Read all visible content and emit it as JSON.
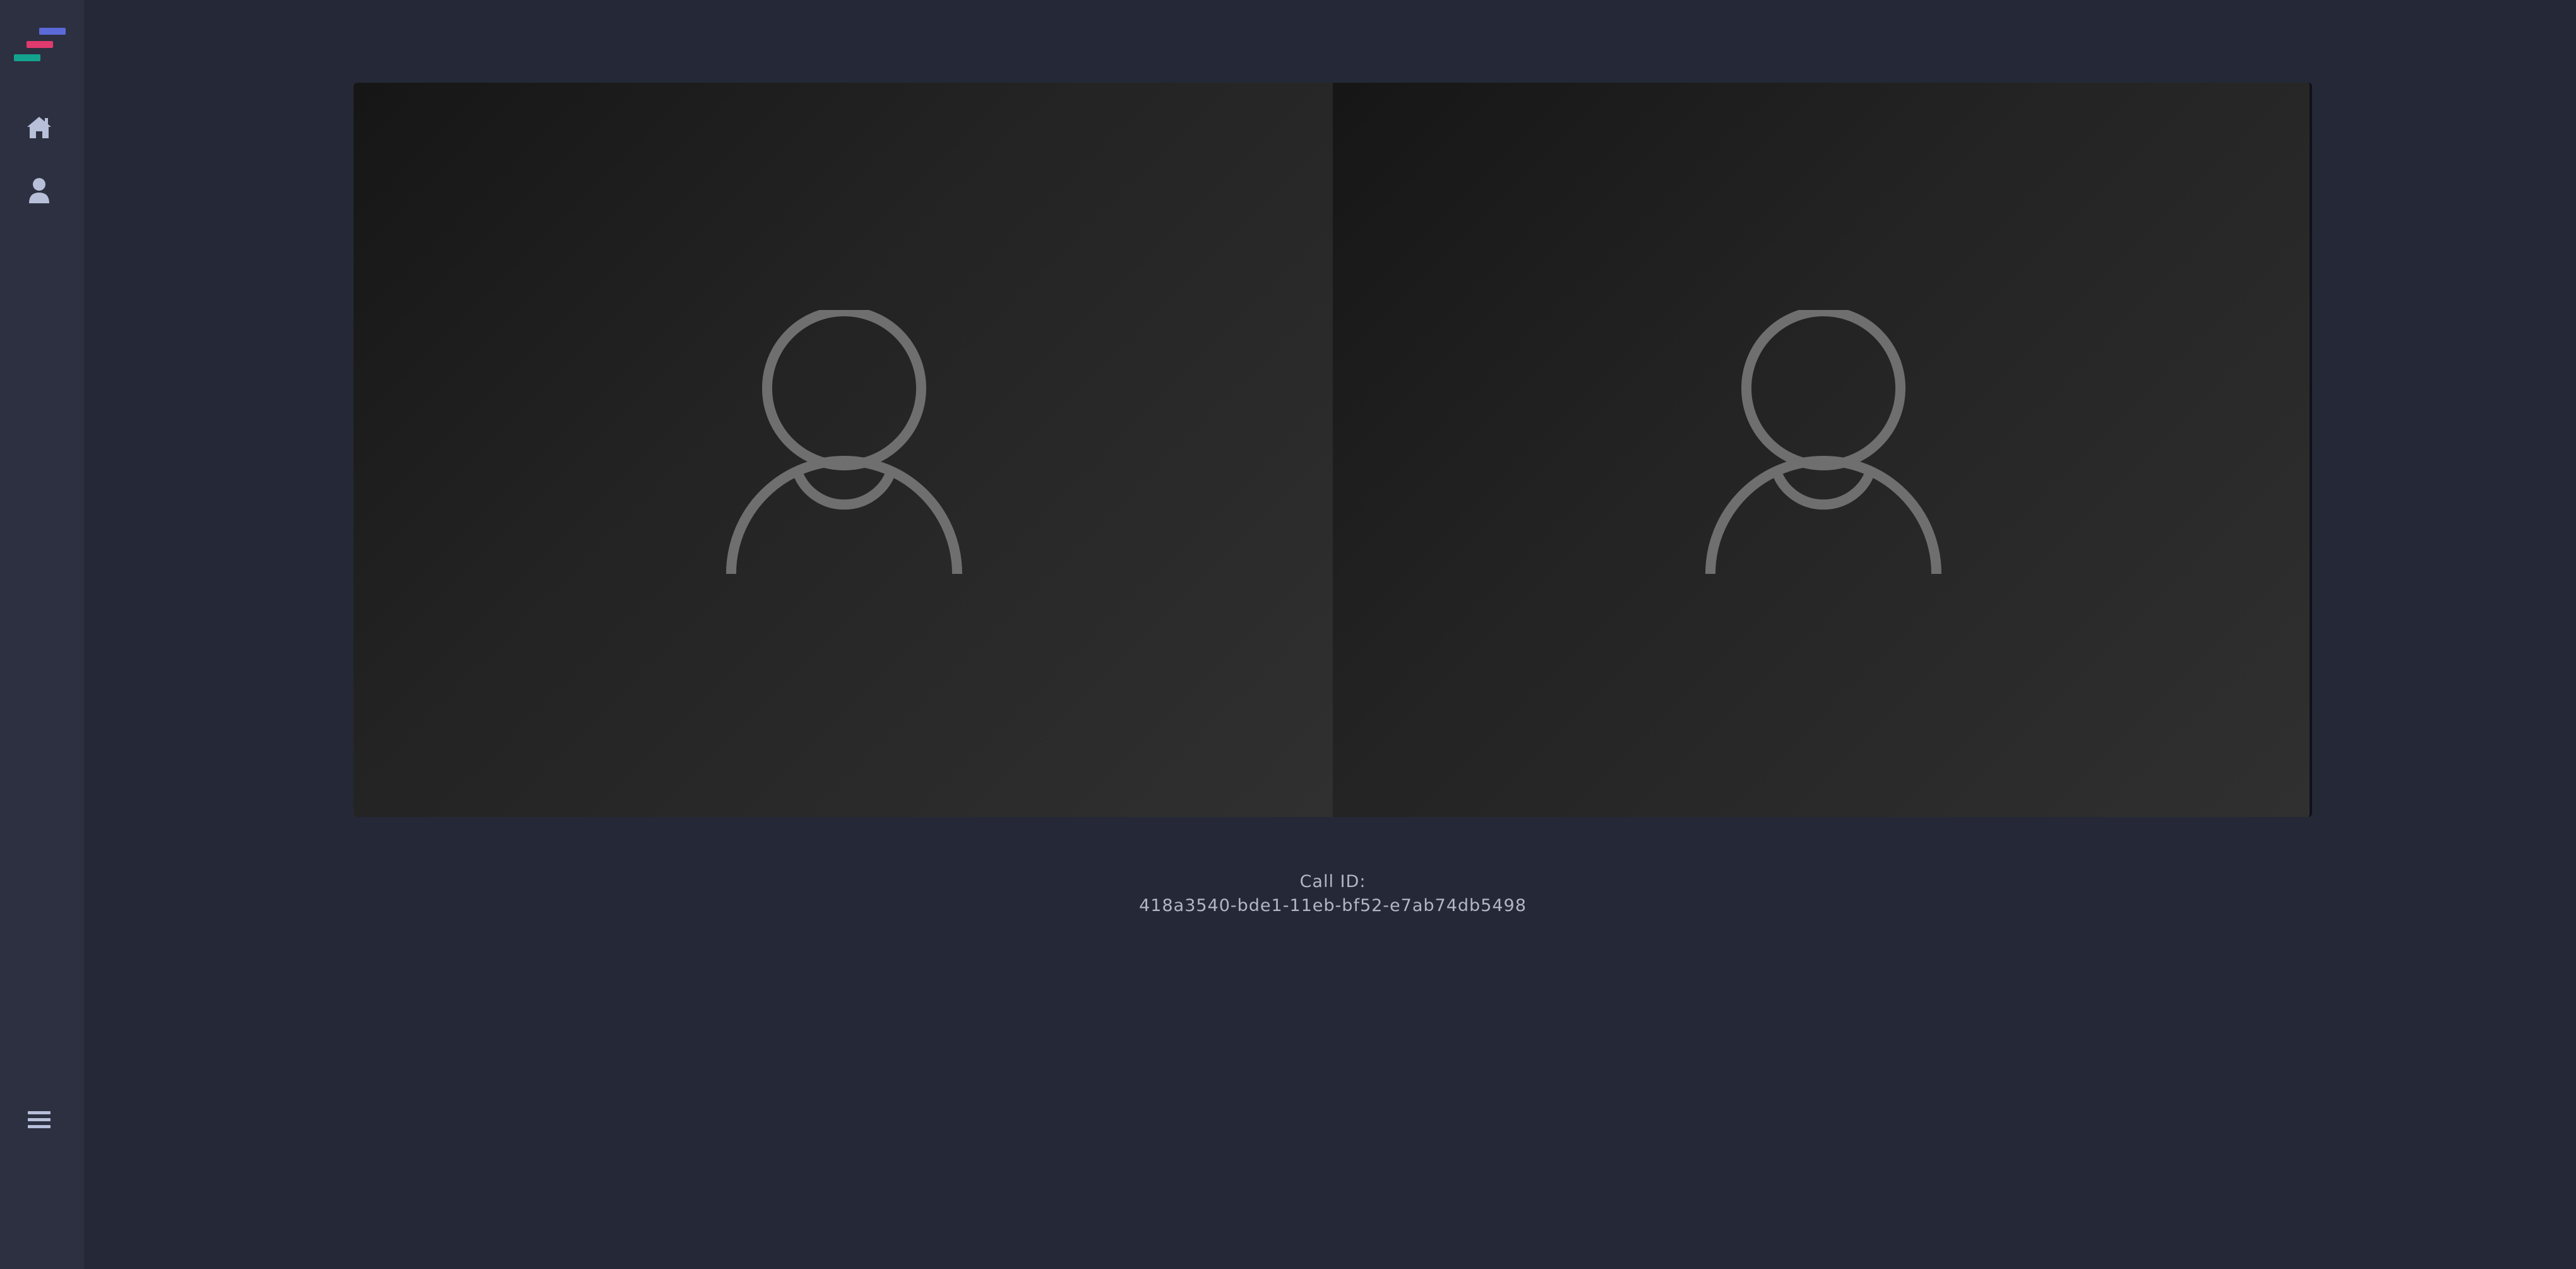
{
  "sidebar": {
    "logo": {
      "name": "app-logo",
      "bar_colors": [
        "#5b6ad8",
        "#e03a6e",
        "#14a38f"
      ]
    },
    "nav_items": [
      {
        "id": "home",
        "icon": "home-icon"
      },
      {
        "id": "profile",
        "icon": "user-icon"
      }
    ],
    "menu_icon": "hamburger-menu-icon",
    "icon_color": "#b7bfd9"
  },
  "video_tiles": [
    {
      "id": "participant-1",
      "placeholder_icon": "avatar-placeholder-icon"
    },
    {
      "id": "participant-2",
      "placeholder_icon": "avatar-placeholder-icon"
    }
  ],
  "call": {
    "label": "Call ID:",
    "id": "418a3540-bde1-11eb-bf52-e7ab74db5498"
  },
  "colors": {
    "background": "#252836",
    "sidebar": "#2d3040",
    "avatar_stroke": "#6f6f6f",
    "text": "#b3b6c4"
  }
}
